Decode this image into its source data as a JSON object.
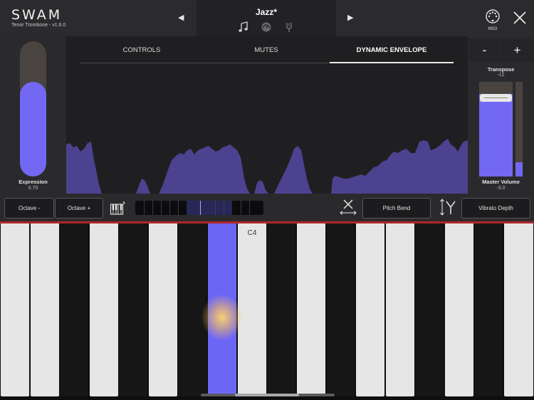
{
  "header": {
    "logo": "SWAM",
    "subtitle": "Tenor Trombone - v1.6.0",
    "preset_name": "Jazz*",
    "prev_arrow": "◀",
    "next_arrow": "▶",
    "midi_label": "MIDI",
    "icons": [
      "music-note-icon",
      "gauge-icon",
      "tuning-fork-icon",
      "midi-icon",
      "close-icon"
    ]
  },
  "tabs": [
    {
      "label": "CONTROLS",
      "active": false
    },
    {
      "label": "MUTES",
      "active": false
    },
    {
      "label": "DYNAMIC ENVELOPE",
      "active": true
    }
  ],
  "expression": {
    "label": "Expression",
    "value": "0.70",
    "level": 0.7
  },
  "transpose": {
    "minus": "-",
    "plus": "+",
    "label": "Transpose",
    "value": "-12"
  },
  "master_volume": {
    "label": "Master Volume",
    "value": "-3.0",
    "fader_level": 0.87,
    "meter_level": 0.15
  },
  "controls": {
    "octave_minus": "Octave -",
    "octave_plus": "Octave +",
    "pitch_bend": "Pitch Bend",
    "vibrato_depth": "Vibrato Depth"
  },
  "keyboard": {
    "note_label": "C4",
    "active_key": "black-key-7"
  },
  "colors": {
    "accent": "#6c66f5",
    "envelope": "#4c428f",
    "keyboard_line": "#b0262a",
    "panel": "#2a2a2d"
  }
}
